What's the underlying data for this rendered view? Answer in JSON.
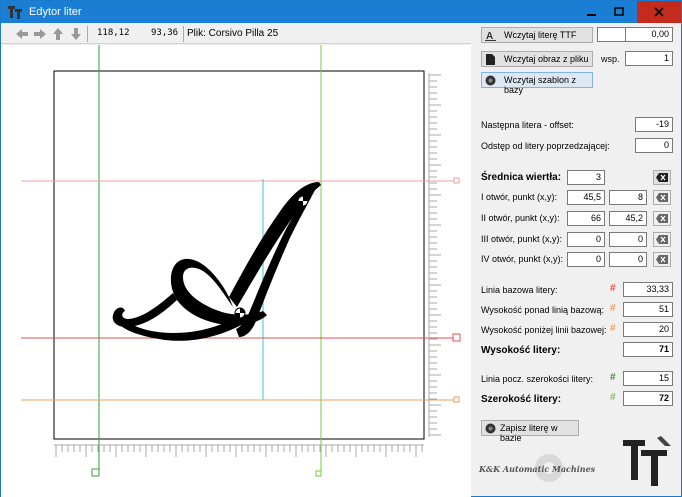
{
  "window": {
    "title": "Edytor liter"
  },
  "toolbar": {
    "coord_x": "118,12",
    "coord_y": "93,36",
    "file_label": "Plik: Corsivo Pilla 25"
  },
  "panel": {
    "load_ttf_label": "Wczytaj  literę TTF",
    "load_ttf_field1": "",
    "load_ttf_field2": "0,00",
    "load_image_label": "Wczytaj  obraz z pliku",
    "wsp_label": "wsp.",
    "wsp_value": "1",
    "load_template_label": "Wczytaj  szablon z bazy",
    "next_offset_label": "Następna litera - offset:",
    "next_offset_value": "-19",
    "spacing_label": "Odstęp od litery poprzedzającej:",
    "spacing_value": "0",
    "drill_label": "Średnica wiertła:",
    "drill_value": "3",
    "holes": [
      {
        "label": "I otwór, punkt (x,y):",
        "x": "45,5",
        "y": "8"
      },
      {
        "label": "II otwór, punkt (x,y):",
        "x": "66",
        "y": "45,2"
      },
      {
        "label": "III otwór, punkt (x,y):",
        "x": "0",
        "y": "0"
      },
      {
        "label": "IV otwór, punkt (x,y):",
        "x": "0",
        "y": "0"
      }
    ],
    "baseline_label": "Linia bazowa litery:",
    "baseline_value": "33,33",
    "above_label": "Wysokość ponad linią bazową:",
    "above_value": "51",
    "below_label": "Wysokość poniżej linii bazowej:",
    "below_value": "20",
    "height_label": "Wysokość litery:",
    "height_value": "71",
    "width_start_label": "Linia pocz. szerokości litery:",
    "width_start_value": "15",
    "width_label": "Szerokość litery:",
    "width_value": "72",
    "save_label": "Zapisz literę w bazie",
    "hash": "#",
    "logo_text": "K&K Automatic Machines"
  },
  "colors": {
    "red": "#e05050",
    "orange": "#e8a060",
    "green": "#30a030",
    "lightgreen": "#70d030",
    "cyan": "#40c0d8",
    "titlebar": "#1a7fd4"
  }
}
